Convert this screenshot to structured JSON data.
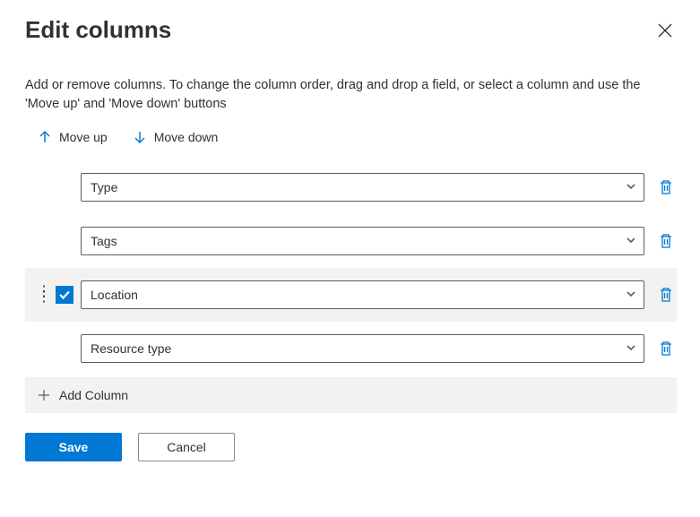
{
  "header": {
    "title": "Edit columns"
  },
  "description": "Add or remove columns. To change the column order, drag and drop a field, or select a column and use the 'Move up' and 'Move down' buttons",
  "toolbar": {
    "move_up": "Move up",
    "move_down": "Move down"
  },
  "columns": [
    {
      "label": "Type",
      "selected": false
    },
    {
      "label": "Tags",
      "selected": false
    },
    {
      "label": "Location",
      "selected": true
    },
    {
      "label": "Resource type",
      "selected": false
    }
  ],
  "add_column_label": "Add Column",
  "footer": {
    "save": "Save",
    "cancel": "Cancel"
  }
}
